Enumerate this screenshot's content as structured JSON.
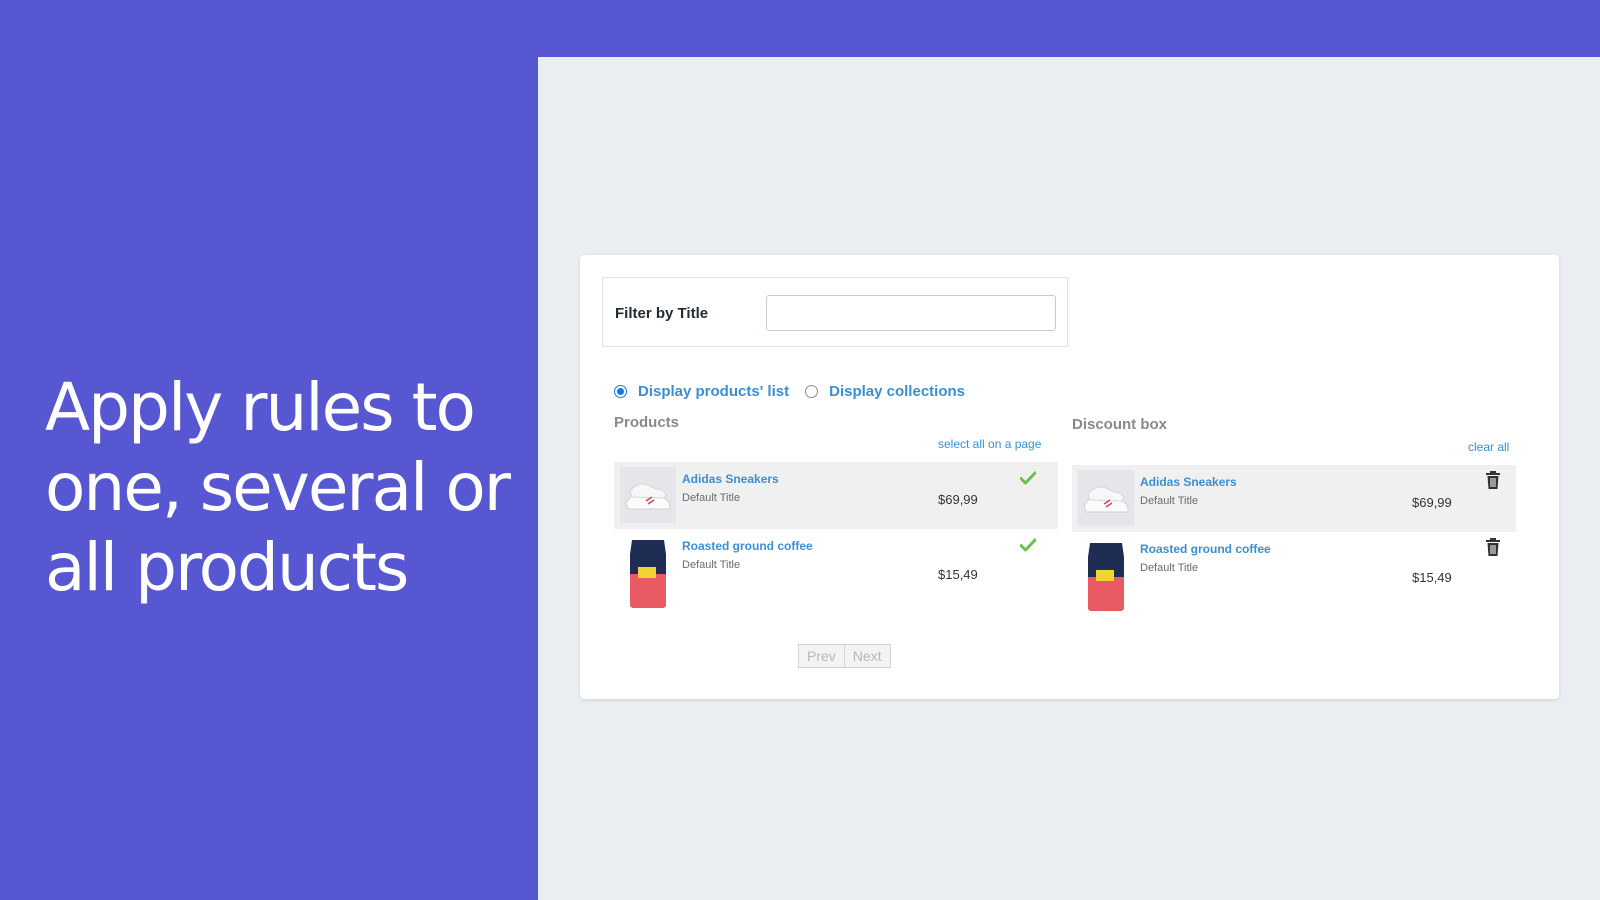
{
  "headline": {
    "line1": "Apply rules to",
    "line2": "one, several or",
    "line3": "all products"
  },
  "filter": {
    "label": "Filter by Title",
    "value": "",
    "placeholder": ""
  },
  "display_options": [
    {
      "label": "Display products' list",
      "checked": true
    },
    {
      "label": "Display collections",
      "checked": false
    }
  ],
  "products_panel": {
    "title": "Products",
    "action_link": "select all on a page",
    "items": [
      {
        "title": "Adidas Sneakers",
        "variant": "Default Title",
        "price": "$69,99",
        "icon": "check-icon"
      },
      {
        "title": "Roasted ground coffee",
        "variant": "Default Title",
        "price": "$15,49",
        "icon": "check-icon"
      }
    ]
  },
  "discount_panel": {
    "title": "Discount box",
    "action_link": "clear all",
    "items": [
      {
        "title": "Adidas Sneakers",
        "variant": "Default Title",
        "price": "$69,99",
        "icon": "trash-icon"
      },
      {
        "title": "Roasted ground coffee",
        "variant": "Default Title",
        "price": "$15,49",
        "icon": "trash-icon"
      }
    ]
  },
  "pagination": {
    "prev_label": "Prev",
    "next_label": "Next"
  },
  "colors": {
    "background": "#5757d1",
    "screen": "#eaedf1",
    "link": "#3b8fd0",
    "check": "#6cc04a",
    "row_highlight": "#f0f0f0"
  }
}
